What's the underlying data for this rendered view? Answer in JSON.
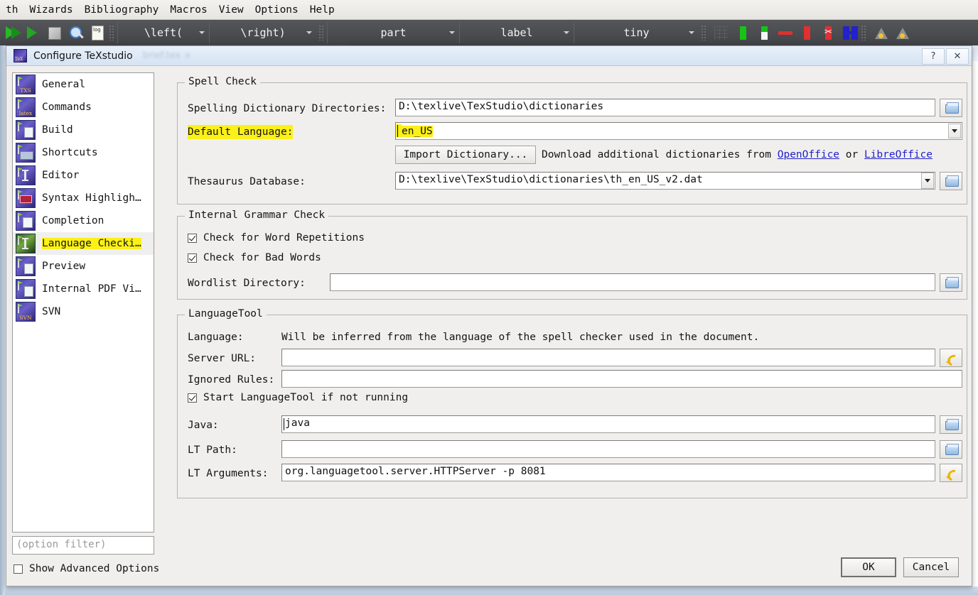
{
  "app": {
    "menubar": [
      "th",
      "Wizards",
      "Bibliography",
      "Macros",
      "View",
      "Options",
      "Help"
    ],
    "toolbar": {
      "combos": [
        {
          "label": "\\left("
        },
        {
          "label": "\\right)"
        },
        {
          "label": "part"
        },
        {
          "label": "label"
        },
        {
          "label": "tiny"
        }
      ]
    }
  },
  "dialog": {
    "title": "Configure TeXstudio",
    "help_button": "?",
    "close_button": "✕",
    "sidebar": {
      "items": [
        {
          "label": "General",
          "icon": "txs-icon",
          "selected": false,
          "highlighted": false
        },
        {
          "label": "Commands",
          "icon": "latex-icon",
          "selected": false,
          "highlighted": false
        },
        {
          "label": "Build",
          "icon": "build-icon",
          "selected": false,
          "highlighted": false
        },
        {
          "label": "Shortcuts",
          "icon": "keyboard-icon",
          "selected": false,
          "highlighted": false
        },
        {
          "label": "Editor",
          "icon": "text-cursor-icon",
          "selected": false,
          "highlighted": false
        },
        {
          "label": "Syntax Highligh…",
          "icon": "highlight-icon",
          "selected": false,
          "highlighted": false
        },
        {
          "label": "Completion",
          "icon": "list-icon",
          "selected": false,
          "highlighted": false
        },
        {
          "label": "Language Checki…",
          "icon": "language-icon",
          "selected": true,
          "highlighted": true
        },
        {
          "label": "Preview",
          "icon": "preview-icon",
          "selected": false,
          "highlighted": false
        },
        {
          "label": "Internal PDF Vi…",
          "icon": "pdf-icon",
          "selected": false,
          "highlighted": false
        },
        {
          "label": "SVN",
          "icon": "svn-icon",
          "selected": false,
          "highlighted": false
        }
      ],
      "filter_placeholder": "(option filter)",
      "advanced_options_label": "Show Advanced Options",
      "advanced_options_checked": false
    },
    "spell_check": {
      "legend": "Spell Check",
      "dict_dirs_label": "Spelling Dictionary Directories:",
      "dict_dirs_value": "D:\\texlive\\TexStudio\\dictionaries",
      "default_language_label": "Default Language:",
      "default_language_value": "en_US",
      "import_dictionary_button": "Import Dictionary...",
      "download_text_pre": "Download additional dictionaries from ",
      "download_link_1": "OpenOffice",
      "download_text_mid": " or ",
      "download_link_2": "LibreOffice",
      "thesaurus_label": "Thesaurus Database:",
      "thesaurus_value": "D:\\texlive\\TexStudio\\dictionaries\\th_en_US_v2.dat"
    },
    "grammar_check": {
      "legend": "Internal Grammar Check",
      "word_repetitions_label": "Check for Word Repetitions",
      "word_repetitions_checked": true,
      "bad_words_label": "Check for Bad Words",
      "bad_words_checked": true,
      "wordlist_label": "Wordlist Directory:",
      "wordlist_value": ""
    },
    "language_tool": {
      "legend": "LanguageTool",
      "language_label": "Language:",
      "language_note": "Will be inferred from the language of the spell checker used in the document.",
      "server_url_label": "Server URL:",
      "server_url_value": "",
      "ignored_rules_label": "Ignored Rules:",
      "ignored_rules_value": "",
      "start_lt_label": "Start LanguageTool if not running",
      "start_lt_checked": true,
      "java_label": "Java:",
      "java_value": "java",
      "lt_path_label": "LT Path:",
      "lt_path_value": "",
      "lt_args_label": "LT Arguments:",
      "lt_args_value": "org.languagetool.server.HTTPServer -p 8081"
    },
    "footer": {
      "ok_label": "OK",
      "cancel_label": "Cancel"
    }
  },
  "colors": {
    "highlight": "#fbf018",
    "link": "#2222cc",
    "dialog_bg": "#f0efed",
    "titlebar": "#d5e3f3"
  }
}
